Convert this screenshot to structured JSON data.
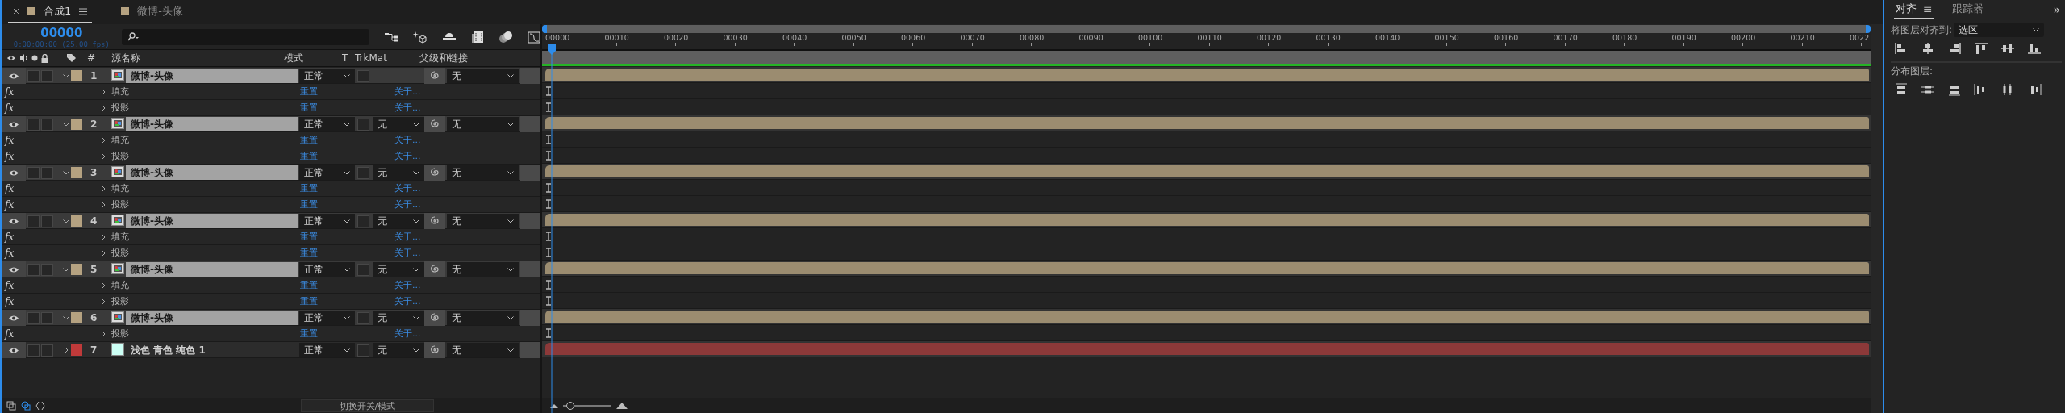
{
  "tabs": [
    {
      "label": "合成1",
      "selected": true,
      "color": "#b5a281"
    },
    {
      "label": "微博-头像",
      "selected": false,
      "color": "#b5a281"
    }
  ],
  "timecode": "00000",
  "timecode_detail": "0:00:00:00 (25.00 fps)",
  "columns": {
    "number": "#",
    "source_name": "源名称",
    "mode": "模式",
    "t": "T",
    "trkmat": "TrkMat",
    "parent": "父级和链接"
  },
  "layers": [
    {
      "number": "1",
      "name": "微博-头像",
      "kind": "comp",
      "color": "#b5a281",
      "visible": true,
      "selected": true,
      "expanded": true,
      "mode": "正常",
      "parent": "无",
      "effects": [
        {
          "fx": "fx",
          "name": "填充",
          "expanded": false,
          "reset": "重置",
          "about": "关于..."
        },
        {
          "fx": "fx",
          "name": "投影",
          "expanded": false,
          "reset": "重置",
          "about": "关于..."
        }
      ]
    },
    {
      "number": "2",
      "name": "微博-头像",
      "kind": "comp",
      "color": "#b5a281",
      "visible": true,
      "selected": true,
      "expanded": true,
      "mode": "正常",
      "trkmat": "无",
      "parent": "无",
      "effects": [
        {
          "fx": "fx",
          "name": "填充",
          "expanded": false,
          "reset": "重置",
          "about": "关于..."
        },
        {
          "fx": "fx",
          "name": "投影",
          "expanded": false,
          "reset": "重置",
          "about": "关于..."
        }
      ]
    },
    {
      "number": "3",
      "name": "微博-头像",
      "kind": "comp",
      "color": "#b5a281",
      "visible": true,
      "selected": true,
      "expanded": true,
      "mode": "正常",
      "trkmat": "无",
      "parent": "无",
      "effects": [
        {
          "fx": "fx",
          "name": "填充",
          "expanded": false,
          "reset": "重置",
          "about": "关于..."
        },
        {
          "fx": "fx",
          "name": "投影",
          "expanded": false,
          "reset": "重置",
          "about": "关于..."
        }
      ]
    },
    {
      "number": "4",
      "name": "微博-头像",
      "kind": "comp",
      "color": "#b5a281",
      "visible": true,
      "selected": true,
      "expanded": true,
      "mode": "正常",
      "trkmat": "无",
      "parent": "无",
      "effects": [
        {
          "fx": "fx",
          "name": "填充",
          "expanded": false,
          "reset": "重置",
          "about": "关于..."
        },
        {
          "fx": "fx",
          "name": "投影",
          "expanded": false,
          "reset": "重置",
          "about": "关于..."
        }
      ]
    },
    {
      "number": "5",
      "name": "微博-头像",
      "kind": "comp",
      "color": "#b5a281",
      "visible": true,
      "selected": true,
      "expanded": true,
      "mode": "正常",
      "trkmat": "无",
      "parent": "无",
      "effects": [
        {
          "fx": "fx",
          "name": "填充",
          "expanded": false,
          "reset": "重置",
          "about": "关于..."
        },
        {
          "fx": "fx",
          "name": "投影",
          "expanded": false,
          "reset": "重置",
          "about": "关于..."
        }
      ]
    },
    {
      "number": "6",
      "name": "微博-头像",
      "kind": "comp",
      "color": "#b5a281",
      "visible": true,
      "selected": true,
      "expanded": true,
      "mode": "正常",
      "trkmat": "无",
      "parent": "无",
      "effects": [
        {
          "fx": "fx",
          "name": "投影",
          "expanded": false,
          "reset": "重置",
          "about": "关于..."
        }
      ]
    },
    {
      "number": "7",
      "name": "浅色 青色 纯色 1",
      "kind": "solid",
      "color": "#c03a3a",
      "visible": true,
      "selected": false,
      "expanded": false,
      "mode": "正常",
      "trkmat": "无",
      "parent": "无"
    }
  ],
  "ruler": [
    "00000",
    "00010",
    "00020",
    "00030",
    "00040",
    "00050",
    "00060",
    "00070",
    "00080",
    "00090",
    "00100",
    "00110",
    "00120",
    "00130",
    "00140",
    "00150",
    "00160",
    "00170",
    "00180",
    "00190",
    "00200",
    "00210",
    "0022"
  ],
  "switch_mode_button": "切换开关/模式",
  "zoom_slider": {
    "level": 0.15
  },
  "align_panel": {
    "tabs": [
      {
        "label": "对齐",
        "selected": true,
        "menu": "≡"
      },
      {
        "label": "跟踪器",
        "selected": false
      }
    ],
    "overflow": "»",
    "align_to_label": "将图层对齐到:",
    "align_to": "选区",
    "distribute_label": "分布图层:"
  }
}
